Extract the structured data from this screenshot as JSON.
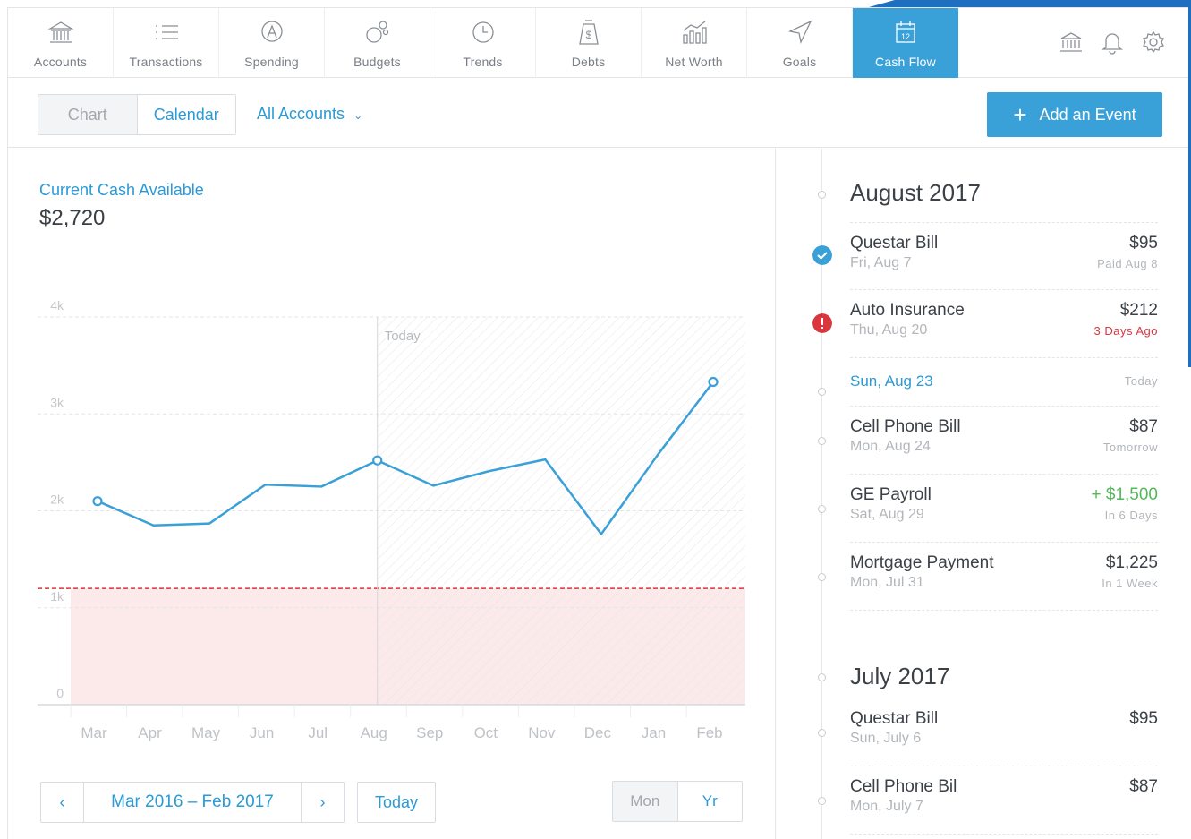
{
  "nav": {
    "items": [
      {
        "label": "Accounts",
        "icon": "bank-icon"
      },
      {
        "label": "Transactions",
        "icon": "list-icon"
      },
      {
        "label": "Spending",
        "icon": "spending-icon"
      },
      {
        "label": "Budgets",
        "icon": "budgets-icon"
      },
      {
        "label": "Trends",
        "icon": "clock-icon"
      },
      {
        "label": "Debts",
        "icon": "debts-icon"
      },
      {
        "label": "Net Worth",
        "icon": "net-worth-icon"
      },
      {
        "label": "Goals",
        "icon": "goals-icon"
      },
      {
        "label": "Cash Flow",
        "icon": "calendar-icon",
        "active": true,
        "calendar_day": "12"
      }
    ],
    "utilities": [
      "bank-icon",
      "bell-icon",
      "gear-icon"
    ]
  },
  "toolbar": {
    "view_chart": "Chart",
    "view_calendar": "Calendar",
    "accounts_filter": "All Accounts",
    "add_event": "Add an Event"
  },
  "summary": {
    "label": "Current Cash Available",
    "value": "$2,720"
  },
  "chart_data": {
    "type": "line",
    "x": [
      "Mar",
      "Apr",
      "May",
      "Jun",
      "Jul",
      "Aug",
      "Sep",
      "Oct",
      "Nov",
      "Dec",
      "Jan",
      "Feb"
    ],
    "series": [
      {
        "values": [
          2100,
          1850,
          1870,
          2270,
          2250,
          2520,
          2260,
          2410,
          2530,
          1760,
          2570,
          3330
        ]
      }
    ],
    "y_ticks": [
      "0",
      "1k",
      "2k",
      "3k",
      "4k"
    ],
    "ylim": [
      0,
      4000
    ],
    "threshold": 1200,
    "today_label": "Today",
    "today_index": 5,
    "colors": {
      "line": "#3aa0d8",
      "threshold": "#d9363e",
      "danger_fill": "#fbe6e7"
    }
  },
  "range": {
    "text": "Mar 2016 – Feb 2017",
    "today_button": "Today",
    "period_mon": "Mon",
    "period_yr": "Yr"
  },
  "timeline": {
    "months": [
      {
        "title": "August 2017",
        "events": [
          {
            "title": "Questar Bill",
            "date": "Fri, Aug 7",
            "amount": "$95",
            "status": "Paid Aug 8",
            "state": "paid"
          },
          {
            "title": "Auto Insurance",
            "date": "Thu, Aug 20",
            "amount": "$212",
            "status": "3 Days Ago",
            "state": "overdue"
          },
          {
            "today": true,
            "title": "Sun, Aug 23",
            "status": "Today"
          },
          {
            "title": "Cell Phone Bill",
            "date": "Mon, Aug 24",
            "amount": "$87",
            "status": "Tomorrow"
          },
          {
            "title": "GE Payroll",
            "date": "Sat, Aug 29",
            "amount": "+ $1,500",
            "status": "In 6 Days",
            "income": true
          },
          {
            "title": "Mortgage Payment",
            "date": "Mon, Jul 31",
            "amount": "$1,225",
            "status": "In 1 Week"
          }
        ]
      },
      {
        "title": "July 2017",
        "events": [
          {
            "title": "Questar Bill",
            "date": "Sun, July 6",
            "amount": "$95",
            "status": ""
          },
          {
            "title": "Cell Phone Bil",
            "date": "Mon, July 7",
            "amount": "$87",
            "status": ""
          }
        ]
      }
    ]
  }
}
